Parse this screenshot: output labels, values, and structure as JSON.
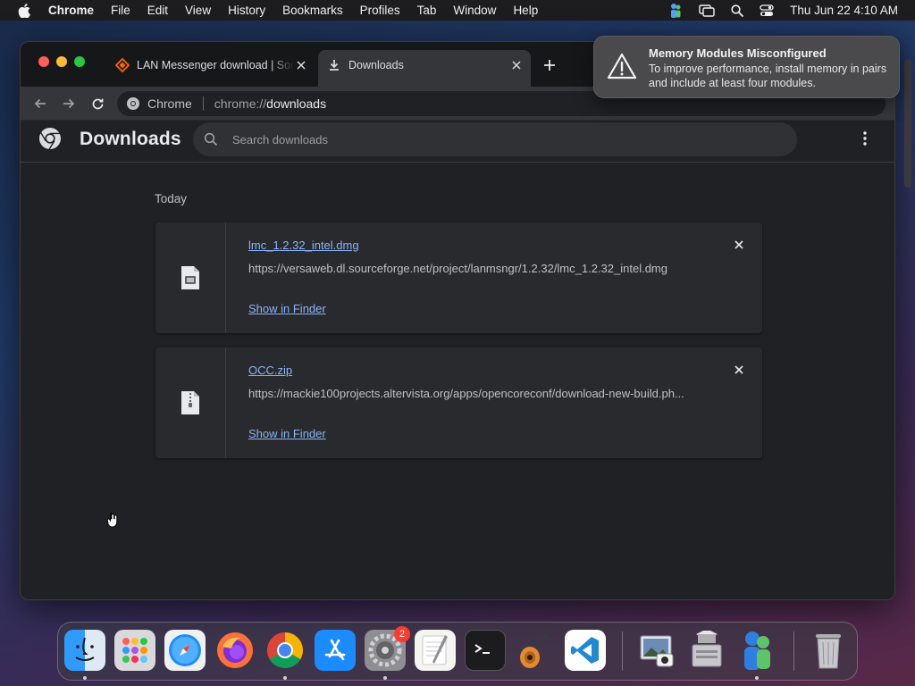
{
  "menubar": {
    "app_name": "Chrome",
    "items": [
      "File",
      "Edit",
      "View",
      "History",
      "Bookmarks",
      "Profiles",
      "Tab",
      "Window",
      "Help"
    ],
    "clock": "Thu Jun 22  4:10 AM"
  },
  "browser": {
    "tabs": [
      {
        "title": "LAN Messenger download | SourceForge.net"
      },
      {
        "title": "Downloads"
      }
    ],
    "omnibox": {
      "chip": "Chrome",
      "url_scheme": "chrome://",
      "url_host": "downloads"
    }
  },
  "downloads": {
    "page_title": "Downloads",
    "search_placeholder": "Search downloads",
    "date_group": "Today",
    "items": [
      {
        "file_name": "lmc_1.2.32_intel.dmg",
        "url": "https://versaweb.dl.sourceforge.net/project/lanmsngr/1.2.32/lmc_1.2.32_intel.dmg",
        "action": "Show in Finder"
      },
      {
        "file_name": "OCC.zip",
        "url": "https://mackie100projects.altervista.org/apps/opencoreconf/download-new-build.ph...",
        "action": "Show in Finder"
      }
    ]
  },
  "notification": {
    "title": "Memory Modules Misconfigured",
    "body": "To improve performance, install memory in pairs and include at least four modules."
  },
  "dock": {
    "system_preferences_badge": "2",
    "apps": [
      "finder-icon",
      "launchpad-icon",
      "safari-icon",
      "firefox-icon",
      "chrome-icon",
      "app-store-icon",
      "system-preferences-icon",
      "textedit-icon",
      "terminal-icon",
      "garageband-icon",
      "vscode-icon",
      "preview-icon",
      "bootcamp-icon",
      "lan-messenger-icon",
      "trash-icon"
    ]
  },
  "colors": {
    "link": "#8ab4f8",
    "page_bg": "#202124",
    "card_bg": "#292a2d",
    "sourceforge_accent": "#ff6600"
  }
}
